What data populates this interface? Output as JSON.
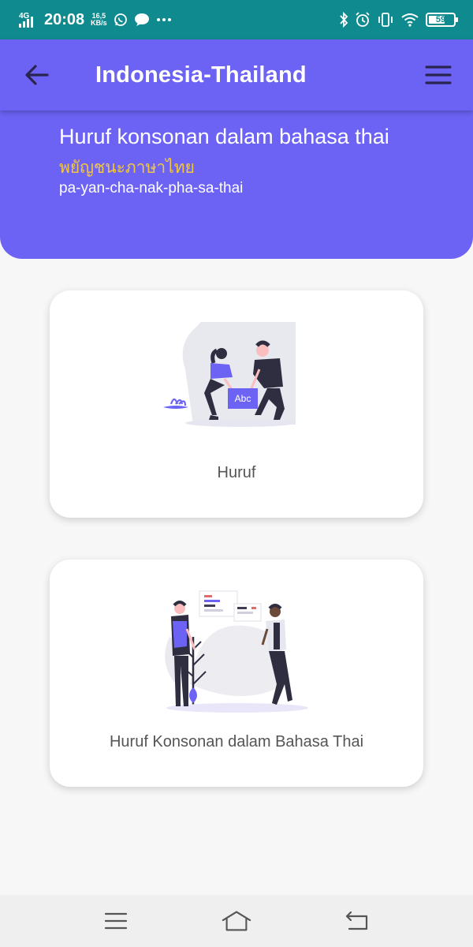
{
  "status_bar": {
    "network": "4G",
    "time": "20:08",
    "speed_value": "16,5",
    "speed_unit": "KB/s",
    "battery": "59",
    "icons": [
      "whatsapp-icon",
      "chat-bubble-icon",
      "more-dots-icon",
      "bluetooth-icon",
      "alarm-icon",
      "vibrate-icon",
      "wifi-icon",
      "battery-icon"
    ]
  },
  "app_bar": {
    "title": "Indonesia-Thailand",
    "back_icon": "arrow-left-icon",
    "menu_icon": "hamburger-menu-icon"
  },
  "header": {
    "title": "Huruf konsonan dalam bahasa thai",
    "thai": "พยัญชนะภาษาไทย",
    "romanization": "pa-yan-cha-nak-pha-sa-thai"
  },
  "cards": [
    {
      "label": "Huruf",
      "illustration_text": "Abc"
    },
    {
      "label": "Huruf Konsonan dalam Bahasa Thai"
    }
  ],
  "nav_bar": {
    "icons": [
      "recents-icon",
      "home-icon",
      "back-icon"
    ]
  },
  "colors": {
    "status_bar": "#0f8a8f",
    "primary": "#6c63f5",
    "thai_text": "#f3c640",
    "background": "#f7f7f7"
  }
}
